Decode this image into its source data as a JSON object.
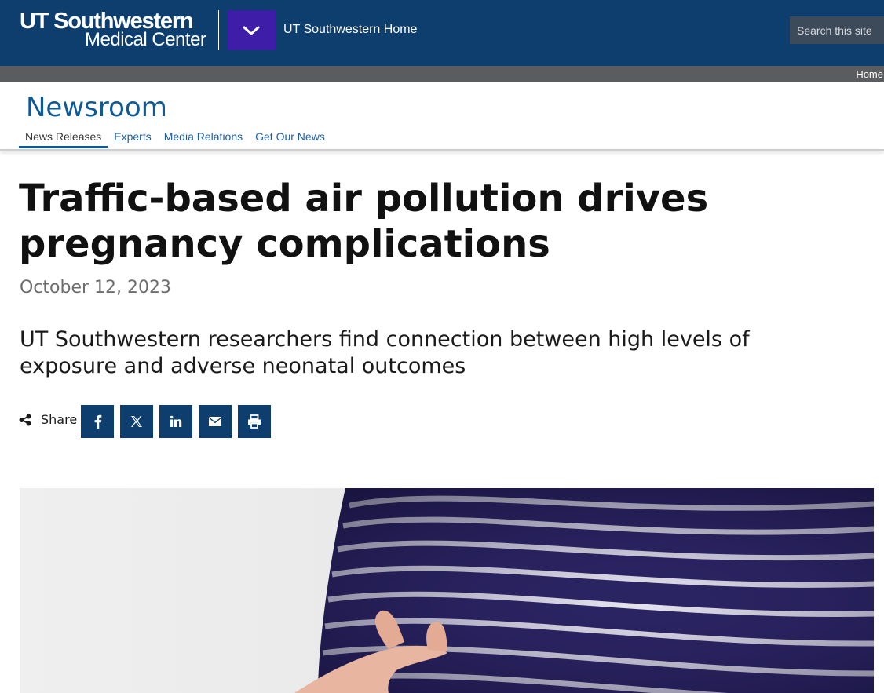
{
  "header": {
    "logo_line1": "UT Southwestern",
    "logo_line2": "Medical Center",
    "home_link": "UT Southwestern Home",
    "menu_toggle_icon": "chevron-down-icon",
    "search": {
      "placeholder": "Search this site"
    },
    "colors": {
      "bar": "#0d3e6d",
      "menu_button": "#3e1ea8",
      "search_box": "#3d4a5a"
    }
  },
  "breadcrumb": {
    "home": "Home"
  },
  "section": {
    "title": "Newsroom",
    "tabs": [
      {
        "label": "News Releases",
        "active": true
      },
      {
        "label": "Experts",
        "active": false
      },
      {
        "label": "Media Relations",
        "active": false
      },
      {
        "label": "Get Our News",
        "active": false
      }
    ]
  },
  "article": {
    "headline": "Traffic-based air pollution drives pregnancy complications",
    "date": "October 12, 2023",
    "subheadline": "UT Southwestern researchers find connection between high levels of exposure and adverse neonatal outcomes",
    "share": {
      "label": "Share",
      "icon": "share-nodes-icon",
      "buttons": [
        "facebook-icon",
        "x-twitter-icon",
        "linkedin-icon",
        "envelope-icon",
        "print-icon"
      ]
    },
    "hero_image_subject": "hand resting on pregnant belly in striped navy and white top"
  }
}
